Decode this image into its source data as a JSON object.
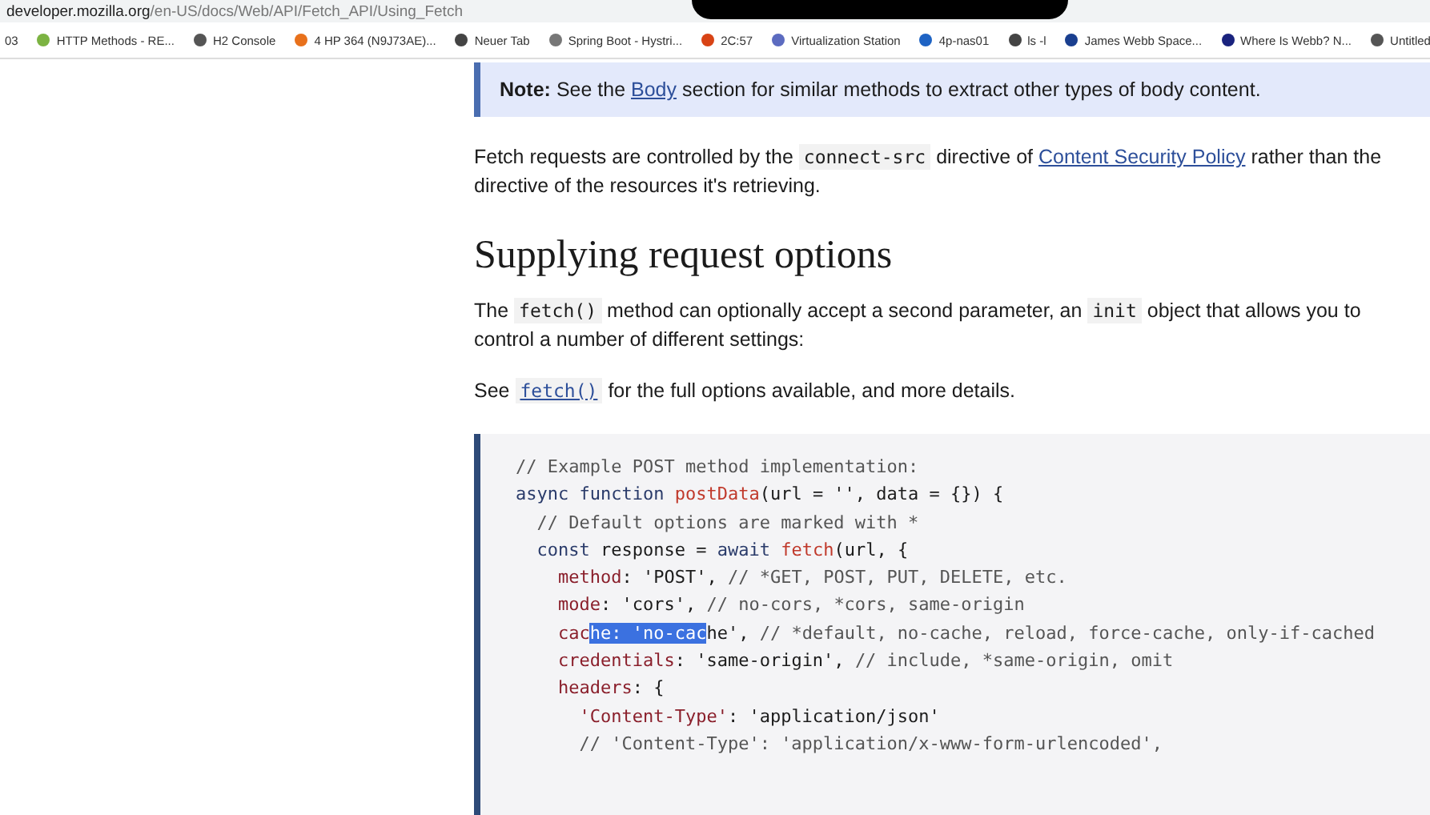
{
  "address_bar": {
    "host": "developer.mozilla.org",
    "path": "/en-US/docs/Web/API/Fetch_API/Using_Fetch"
  },
  "bookmarks": [
    {
      "label": "03"
    },
    {
      "label": "HTTP Methods - RE...",
      "color": "#7cb342"
    },
    {
      "label": "H2 Console",
      "color": "#555555"
    },
    {
      "label": "4 HP 364 (N9J73AE)...",
      "color": "#e8711c"
    },
    {
      "label": "Neuer Tab",
      "color": "#444444"
    },
    {
      "label": "Spring Boot - Hystri...",
      "color": "#777777"
    },
    {
      "label": "2C:57",
      "color": "#d84315"
    },
    {
      "label": "Virtualization Station",
      "color": "#5c6bc0"
    },
    {
      "label": "4p-nas01",
      "color": "#1e63c4"
    },
    {
      "label": "ls -l",
      "color": "#444444"
    },
    {
      "label": "James Webb Space...",
      "color": "#1a3f8f"
    },
    {
      "label": "Where Is Webb? N...",
      "color": "#1a237e"
    },
    {
      "label": "Untitled",
      "color": "#555555"
    }
  ],
  "note": {
    "label": "Note:",
    "before": "See the",
    "link": "Body",
    "after": "section for similar methods to extract other types of body content."
  },
  "paragraph_1": {
    "before": "Fetch requests are controlled by the",
    "code": "connect-src",
    "middle": "directive of",
    "link": "Content Security Policy",
    "after": "rather than the directive of the resources it's retrieving."
  },
  "heading": "Supplying request options",
  "paragraph_2": {
    "before": "The",
    "code": "fetch()",
    "middle": "method can optionally accept a second parameter, an",
    "code_2": "init",
    "after": "object that allows you to control a number of different settings:"
  },
  "paragraph_3": {
    "before": "See",
    "link": "fetch()",
    "after": "for the full options available, and more details."
  },
  "code_lines": [
    {
      "tokens": [
        {
          "kind": "comment",
          "text": "// Example POST method implementation:",
          "selected": false
        }
      ]
    },
    {
      "tokens": [
        {
          "kind": "keyword",
          "text": "async function ",
          "selected": false
        },
        {
          "kind": "function",
          "text": "postData",
          "selected": false
        },
        {
          "kind": "plain",
          "text": "(url = '', data = {}) {",
          "selected": false
        }
      ]
    },
    {
      "tokens": [
        {
          "kind": "comment",
          "text": "  // Default options are marked with *",
          "selected": false
        }
      ]
    },
    {
      "tokens": [
        {
          "kind": "keyword",
          "text": "  const ",
          "selected": false
        },
        {
          "kind": "plain",
          "text": "response = ",
          "selected": false
        },
        {
          "kind": "keyword",
          "text": "await ",
          "selected": false
        },
        {
          "kind": "function",
          "text": "fetch",
          "selected": false
        },
        {
          "kind": "plain",
          "text": "(url, {",
          "selected": false
        }
      ]
    },
    {
      "tokens": [
        {
          "kind": "property",
          "text": "    method",
          "selected": false
        },
        {
          "kind": "plain",
          "text": ": 'POST', ",
          "selected": false
        },
        {
          "kind": "comment",
          "text": "// *GET, POST, PUT, DELETE, etc.",
          "selected": false
        }
      ]
    },
    {
      "tokens": [
        {
          "kind": "property",
          "text": "    mode",
          "selected": false
        },
        {
          "kind": "plain",
          "text": ": 'cors', ",
          "selected": false
        },
        {
          "kind": "comment",
          "text": "// no-cors, *cors, same-origin",
          "selected": false
        }
      ]
    },
    {
      "tokens": [
        {
          "kind": "property",
          "text": "    cac",
          "selected": false
        },
        {
          "kind": "property",
          "text": "he",
          "selected": true
        },
        {
          "kind": "plain",
          "text": ": 'no-cac",
          "selected": true
        },
        {
          "kind": "plain",
          "text": "he', ",
          "selected": false
        },
        {
          "kind": "comment",
          "text": "// *default, no-cache, reload, force-cache, only-if-cached",
          "selected": false
        }
      ]
    },
    {
      "tokens": [
        {
          "kind": "property",
          "text": "    credentials",
          "selected": false
        },
        {
          "kind": "plain",
          "text": ": 'same-origin', ",
          "selected": false
        },
        {
          "kind": "comment",
          "text": "// include, *same-origin, omit",
          "selected": false
        }
      ]
    },
    {
      "tokens": [
        {
          "kind": "property",
          "text": "    headers",
          "selected": false
        },
        {
          "kind": "plain",
          "text": ": {",
          "selected": false
        }
      ]
    },
    {
      "tokens": [
        {
          "kind": "string",
          "text": "      'Content-Type'",
          "selected": false
        },
        {
          "kind": "plain",
          "text": ": 'application/json'",
          "selected": false
        }
      ]
    },
    {
      "tokens": [
        {
          "kind": "comment",
          "text": "      // 'Content-Type': 'application/x-www-form-urlencoded',",
          "selected": false
        }
      ]
    }
  ]
}
